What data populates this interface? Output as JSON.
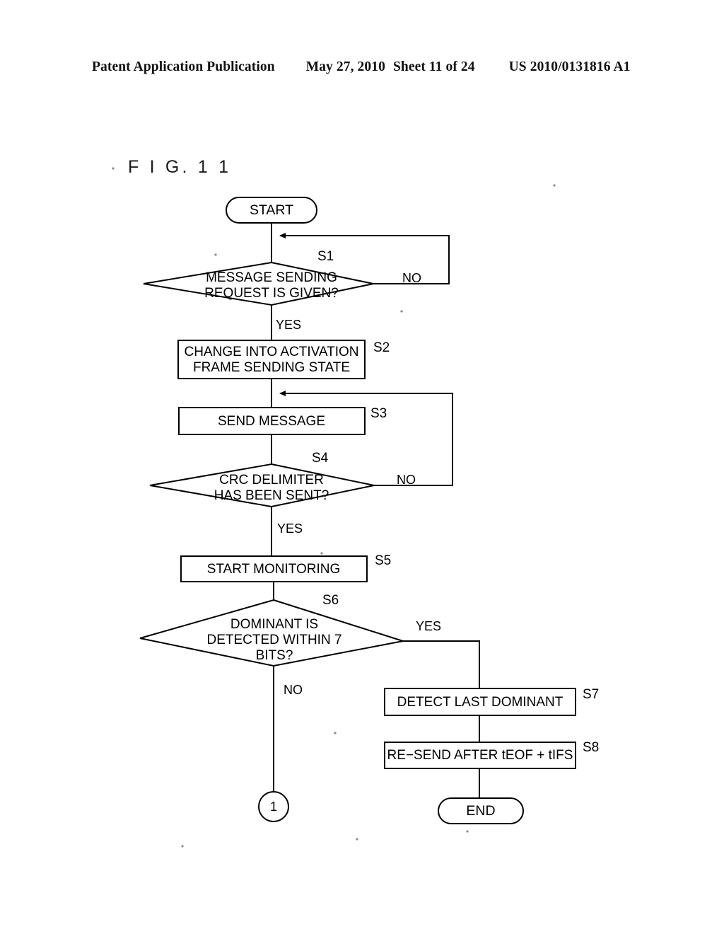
{
  "header": {
    "publication": "Patent Application Publication",
    "date": "May 27, 2010",
    "sheet": "Sheet 11 of 24",
    "patent_number": "US 2010/0131816 A1"
  },
  "figure": {
    "label": "F I G.  1 1"
  },
  "flowchart": {
    "terminals": {
      "start": "START",
      "end": "END",
      "connector": "1"
    },
    "steps": [
      {
        "tag": "S1",
        "text_lines": [
          "MESSAGE SENDING",
          "REQUEST IS GIVEN?"
        ],
        "shape": "decision"
      },
      {
        "tag": "S2",
        "text_lines": [
          "CHANGE INTO ACTIVATION",
          "FRAME SENDING STATE"
        ],
        "shape": "process"
      },
      {
        "tag": "S3",
        "text_lines": [
          "SEND MESSAGE"
        ],
        "shape": "process"
      },
      {
        "tag": "S4",
        "text_lines": [
          "CRC DELIMITER",
          "HAS BEEN SENT?"
        ],
        "shape": "decision"
      },
      {
        "tag": "S5",
        "text_lines": [
          "START MONITORING"
        ],
        "shape": "process"
      },
      {
        "tag": "S6",
        "text_lines": [
          "DOMINANT IS",
          "DETECTED WITHIN 7",
          "BITS?"
        ],
        "shape": "decision"
      },
      {
        "tag": "S7",
        "text_lines": [
          "DETECT LAST DOMINANT"
        ],
        "shape": "process"
      },
      {
        "tag": "S8",
        "text_lines": [
          "RE−SEND AFTER tEOF + tIFS"
        ],
        "shape": "process"
      }
    ],
    "branches": {
      "s1_no": "NO",
      "s1_yes": "YES",
      "s4_no": "NO",
      "s4_yes": "YES",
      "s6_yes": "YES",
      "s6_no": "NO"
    },
    "colors": {
      "ink": "#000000",
      "paper": "#ffffff"
    }
  }
}
